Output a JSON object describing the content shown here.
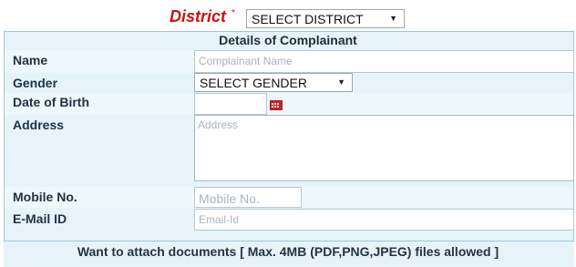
{
  "header": {
    "district_label": "District",
    "required_mark": "*",
    "district_select_value": "SELECT DISTRICT"
  },
  "section_title": "Details of Complainant",
  "fields": {
    "name": {
      "label": "Name",
      "placeholder": "Complainant Name"
    },
    "gender": {
      "label": "Gender",
      "value": "SELECT GENDER"
    },
    "dob": {
      "label": "Date of Birth"
    },
    "address": {
      "label": "Address",
      "placeholder": "Address"
    },
    "mobile": {
      "label": "Mobile No.",
      "placeholder": "Mobile No."
    },
    "email": {
      "label": "E-Mail ID",
      "placeholder": "Email-Id"
    }
  },
  "attach_note": "Want to attach documents [ Max. 4MB (PDF,PNG,JPEG) files allowed ]",
  "colors": {
    "accent_red": "#cc1111",
    "panel_bg": "#e6f4fa",
    "border": "#99c7dd"
  },
  "icons": {
    "calendar": "calendar-icon",
    "dropdown": "chevron-down-icon"
  }
}
